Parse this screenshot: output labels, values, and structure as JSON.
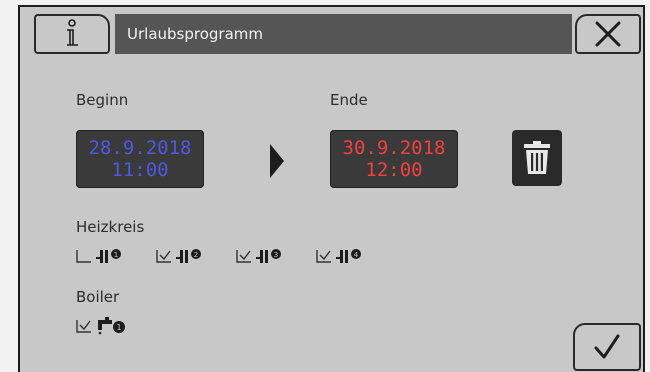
{
  "header": {
    "title": "Urlaubsprogramm"
  },
  "labels": {
    "begin": "Beginn",
    "end": "Ende",
    "heating": "Heizkreis",
    "boiler": "Boiler"
  },
  "begin": {
    "date": "28.9.2018",
    "time": "11:00",
    "color": "#4c5ae0"
  },
  "end": {
    "date": "30.9.2018",
    "time": "12:00",
    "color": "#f04040"
  },
  "heating_circuits": [
    {
      "checked": false,
      "icon": "radiator-icon"
    },
    {
      "checked": true,
      "icon": "radiator-icon"
    },
    {
      "checked": true,
      "icon": "radiator-icon"
    },
    {
      "checked": true,
      "icon": "radiator-icon"
    }
  ],
  "boiler": {
    "checked": true,
    "icon": "tap-icon"
  },
  "icons": {
    "info": "info-icon",
    "close": "close-icon",
    "confirm": "checkmark-icon",
    "delete": "trash-icon"
  }
}
